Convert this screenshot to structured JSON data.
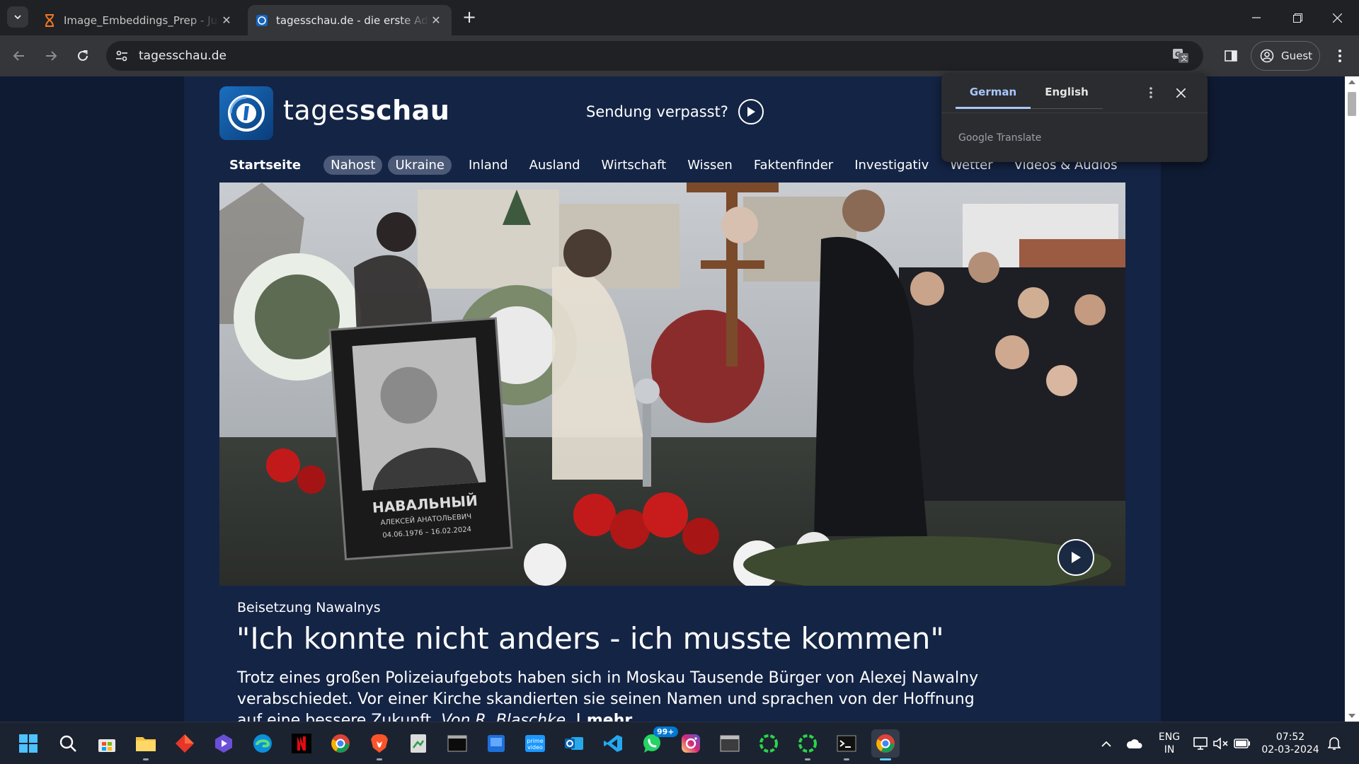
{
  "browser": {
    "tabs": [
      {
        "title": "Image_Embeddings_Prep - Jupyter",
        "active": false
      },
      {
        "title": "tagesschau.de - die erste Adresse für Nachrichten",
        "active": true
      }
    ],
    "url": "tagesschau.de",
    "profile_label": "Guest"
  },
  "translate_popup": {
    "source_lang": "German",
    "target_lang": "English",
    "provider": "Google Translate"
  },
  "site": {
    "brand_light": "tages",
    "brand_bold": "schau",
    "sendung_label": "Sendung verpasst?",
    "nav": {
      "startseite": "Startseite",
      "nahost": "Nahost",
      "ukraine": "Ukraine",
      "inland": "Inland",
      "ausland": "Ausland",
      "wirtschaft": "Wirtschaft",
      "wissen": "Wissen",
      "faktenfinder": "Faktenfinder",
      "investigativ": "Investigativ",
      "wetter": "Wetter",
      "videos": "Videos & Audios"
    }
  },
  "article": {
    "kicker": "Beisetzung Nawalnys",
    "headline": "\"Ich konnte nicht anders - ich musste kommen\"",
    "teaser": "Trotz eines großen Polizeiaufgebots haben sich in Moskau Tausende Bürger von Alexej Nawalny verabschiedet. Vor einer Kirche skandierten sie seinen Namen und sprachen von der Hoffnung auf eine bessere Zukunft.",
    "author": "Von R. Blaschke.",
    "more": "| mehr",
    "photo": {
      "name_line": "НАВАЛЬНЫЙ",
      "sub_line": "АЛЕКСЕЙ АНАТОЛЬЕВИЧ",
      "dates": "04.06.1976 – 16.02.2024"
    }
  },
  "taskbar": {
    "whatsapp_badge": "99+",
    "lang_top": "ENG",
    "lang_bottom": "IN",
    "time": "07:52",
    "date": "02-03-2024"
  },
  "colors": {
    "page_bg": "#0f1b33",
    "content_bg": "#142445",
    "accent_translate": "#a8c7fa"
  }
}
